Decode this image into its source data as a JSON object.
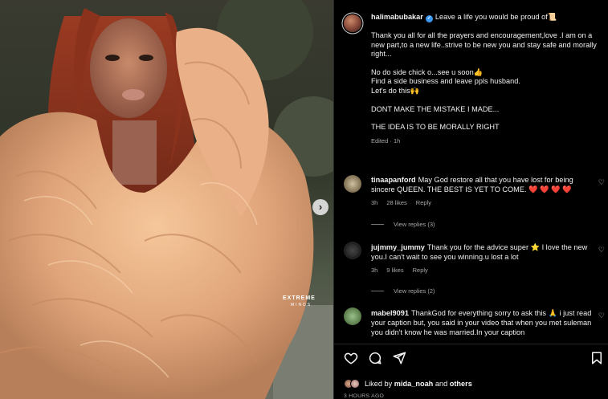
{
  "post": {
    "username": "halimabubakar",
    "caption_lines": [
      "Leave a life you would be proud of📜",
      "",
      "Thank you all for all the prayers and encouragement,love .I am on a new part,to a new life..strive to be new you and stay safe and morally right...",
      "",
      "No do side chick o...see u soon👍",
      "Find a side business and leave ppls husband.",
      "Let's do this🙌",
      "",
      "DONT MAKE THE MISTAKE I MADE...",
      "",
      "THE IDEA IS TO BE MORALLY RIGHT"
    ],
    "edited": "Edited",
    "age": "1h"
  },
  "comments": [
    {
      "username": "tinaapanford",
      "text": "May God restore all that you have lost for being sincere QUEEN. THE BEST IS YET TO COME. ❤️ ❤️ ❤️ ❤️",
      "age": "3h",
      "likes": "28 likes",
      "reply": "Reply",
      "view_replies": "View replies (3)"
    },
    {
      "username": "jujmmy_jummy",
      "text": "Thank you for the advice super ⭐ I love the new you.I can't wait to see you winning.u lost a lot",
      "age": "3h",
      "likes": "9 likes",
      "reply": "Reply",
      "view_replies": "View replies (2)"
    },
    {
      "username": "mabel9091",
      "text": "ThankGod for everything sorry to ask this 🙏 i just read your caption but, you said in your video that when you met suleman you didn't know he was married.In your caption",
      "age": "",
      "likes": "",
      "reply": "",
      "view_replies": ""
    }
  ],
  "likes_line": {
    "prefix": "Liked by ",
    "user": "mida_noah",
    "middle": " and ",
    "others": "others"
  },
  "timestamp": "3 HOURS AGO",
  "watermark": {
    "line1": "EXTREME",
    "line2": "MINDS"
  },
  "icons": {
    "like": "heart-icon",
    "comment": "comment-icon",
    "share": "share-icon",
    "save": "bookmark-icon",
    "next": "chevron-right-icon",
    "comment_like": "small-heart-icon"
  },
  "colors": {
    "background": "#000000",
    "verified": "#3897f0",
    "muted_text": "#a8a8a8"
  }
}
